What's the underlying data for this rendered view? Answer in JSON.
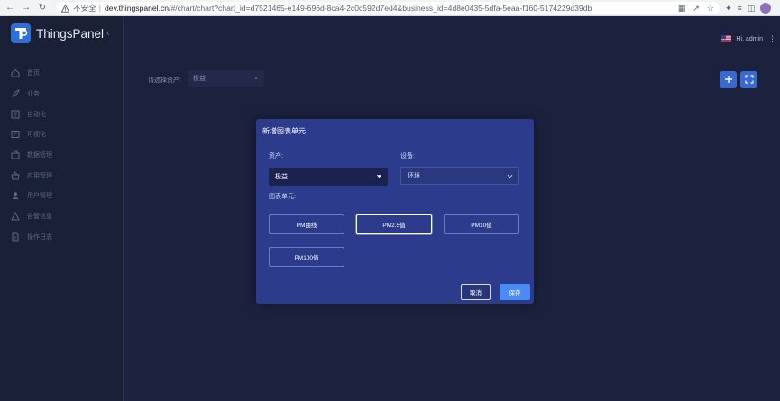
{
  "browser": {
    "security_label": "不安全",
    "url_host": "dev.thingspanel.cn",
    "url_path": "/#/chart/chart?chart_id=d7521465-e149-696d-8ca4-2c0c592d7ed4&business_id=4d8e0435-5dfa-5eaa-f160-5174229d39db"
  },
  "app": {
    "name": "ThingsPanel",
    "logo_letter": "TP"
  },
  "sidebar": {
    "items": [
      {
        "label": "首页",
        "icon": "home-icon"
      },
      {
        "label": "业务",
        "icon": "rocket-icon"
      },
      {
        "label": "自动化",
        "icon": "automation-icon"
      },
      {
        "label": "可视化",
        "icon": "chart-icon"
      },
      {
        "label": "数据管理",
        "icon": "database-icon"
      },
      {
        "label": "应用管理",
        "icon": "basket-icon"
      },
      {
        "label": "用户管理",
        "icon": "user-icon"
      },
      {
        "label": "告警信息",
        "icon": "alert-icon"
      },
      {
        "label": "操作日志",
        "icon": "log-icon"
      }
    ]
  },
  "header": {
    "user_greeting": "Hi, admin"
  },
  "filter": {
    "label": "请选择资产:",
    "value": "极益"
  },
  "dialog": {
    "title": "新增图表单元",
    "asset_label": "资产:",
    "asset_value": "极益",
    "device_label": "设备:",
    "device_value": "环境",
    "units_label": "图表单元:",
    "units": [
      "PM曲线",
      "PM2.5值",
      "PM10值",
      "PM100值"
    ],
    "selected_unit": "PM2.5值",
    "cancel_label": "取消",
    "save_label": "保存"
  },
  "colors": {
    "accent": "#4b8bf5",
    "dialog_bg": "#2c3b8c",
    "sidebar_bg": "#1a2036",
    "main_bg": "#1d2340"
  }
}
